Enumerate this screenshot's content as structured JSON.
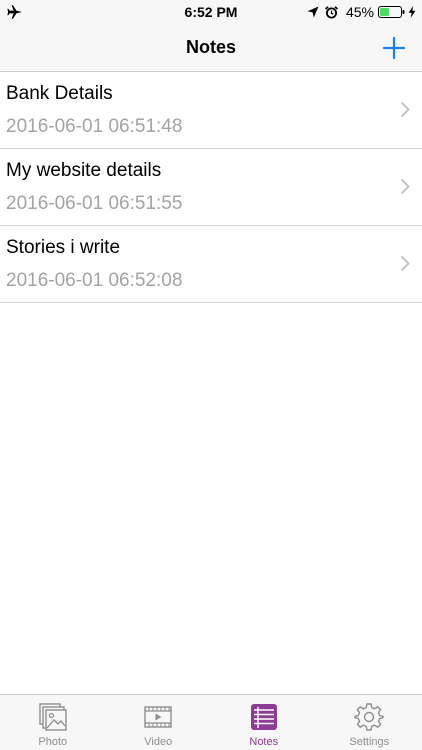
{
  "status_bar": {
    "time": "6:52 PM",
    "battery_percent": "45%",
    "battery_level": 0.45,
    "icons": [
      "airplane-icon",
      "location-arrow-icon",
      "alarm-clock-icon",
      "battery-icon",
      "charging-bolt-icon"
    ]
  },
  "nav": {
    "title": "Notes",
    "add_icon": "plus-icon"
  },
  "notes": [
    {
      "title": "Bank Details",
      "date": "2016-06-01 06:51:48"
    },
    {
      "title": "My website details",
      "date": "2016-06-01 06:51:55"
    },
    {
      "title": "Stories i write",
      "date": "2016-06-01 06:52:08"
    }
  ],
  "tabs": [
    {
      "label": "Photo",
      "icon": "photo-stack-icon",
      "active": false
    },
    {
      "label": "Video",
      "icon": "film-icon",
      "active": false
    },
    {
      "label": "Notes",
      "icon": "notes-list-icon",
      "active": true
    },
    {
      "label": "Settings",
      "icon": "gear-icon",
      "active": false
    }
  ],
  "colors": {
    "accent_blue": "#1a7ef5",
    "active_tab": "#8e3b96",
    "inactive_tab": "#8e8e8e",
    "date_gray": "#a3a3a3",
    "battery_green": "#4cd964"
  }
}
